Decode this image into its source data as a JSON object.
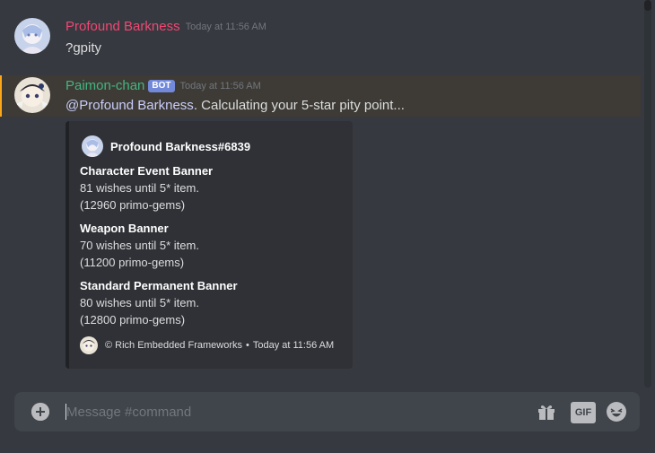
{
  "messages": [
    {
      "username": "Profound Barkness",
      "timestamp": "Today at 11:56 AM",
      "content": "?gpity",
      "name_color": "#f04773"
    },
    {
      "username": "Paimon-chan",
      "bot_tag": "BOT",
      "timestamp": "Today at 11:56 AM",
      "mention": "@Profound Barkness",
      "content_rest": ". Calculating your 5-star pity point...",
      "name_color": "#43b581",
      "highlight_color": "#faa81a"
    }
  ],
  "embed": {
    "author": "Profound Barkness#6839",
    "fields": [
      {
        "name": "Character Event Banner",
        "line1": "81 wishes until 5* item.",
        "line2": "(12960 primo-gems)"
      },
      {
        "name": "Weapon Banner",
        "line1": "70 wishes until 5* item.",
        "line2": "(11200 primo-gems)"
      },
      {
        "name": "Standard Permanent Banner",
        "line1": "80 wishes until 5* item.",
        "line2": "(12800 primo-gems)"
      }
    ],
    "footer_text": "© Rich Embedded Frameworks",
    "footer_separator": "•",
    "footer_time": "Today at 11:56 AM"
  },
  "composer": {
    "placeholder": "Message #command",
    "gif_label": "GIF",
    "icons": [
      "plus-icon",
      "gift-icon",
      "gif-icon",
      "emoji-icon"
    ]
  },
  "colors": {
    "background": "#36393f",
    "embed_bg": "#2f3136",
    "composer_bg": "#40444b",
    "bot_tag": "#7289da",
    "mention": "#c9cdfb"
  }
}
